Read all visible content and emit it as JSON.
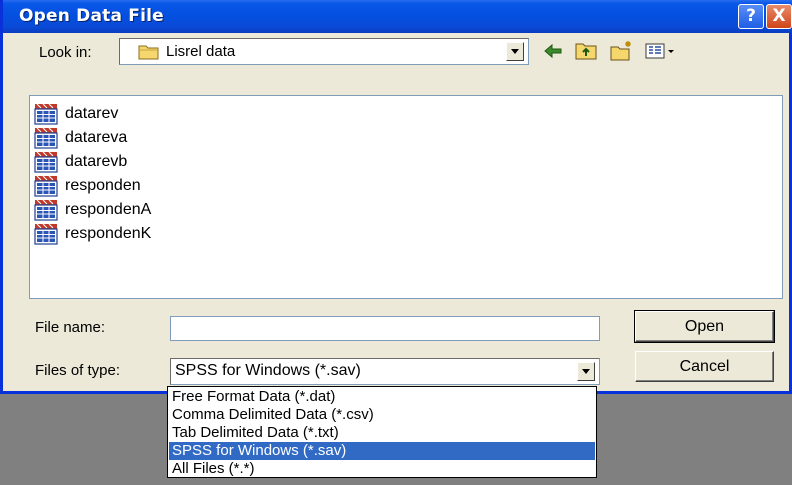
{
  "dialog": {
    "title": "Open Data File",
    "help_label": "?",
    "close_label": "X"
  },
  "look_in": {
    "label": "Look in:",
    "value": "Lisrel data",
    "icons": [
      "back-icon",
      "up-folder-icon",
      "new-folder-icon",
      "view-menu-icon"
    ]
  },
  "files": [
    {
      "name": "datarev",
      "icon": "data-file-icon"
    },
    {
      "name": "datareva",
      "icon": "data-file-icon"
    },
    {
      "name": "datarevb",
      "icon": "data-file-icon"
    },
    {
      "name": "responden",
      "icon": "data-file-icon"
    },
    {
      "name": "respondenA",
      "icon": "data-file-icon"
    },
    {
      "name": "respondenK",
      "icon": "data-file-icon"
    }
  ],
  "file_name": {
    "label": "File name:",
    "value": ""
  },
  "file_type": {
    "label": "Files of type:",
    "value": "SPSS for Windows (*.sav)",
    "options": [
      "Free Format Data (*.dat)",
      "Comma Delimited Data (*.csv)",
      "Tab Delimited Data (*.txt)",
      "SPSS for Windows (*.sav)",
      "All Files (*.*)"
    ],
    "selected_index": 3
  },
  "buttons": {
    "open": "Open",
    "cancel": "Cancel"
  },
  "colors": {
    "title_bar": "#0450e0",
    "selection": "#316ac5",
    "dialog_bg": "#ece9d8"
  }
}
